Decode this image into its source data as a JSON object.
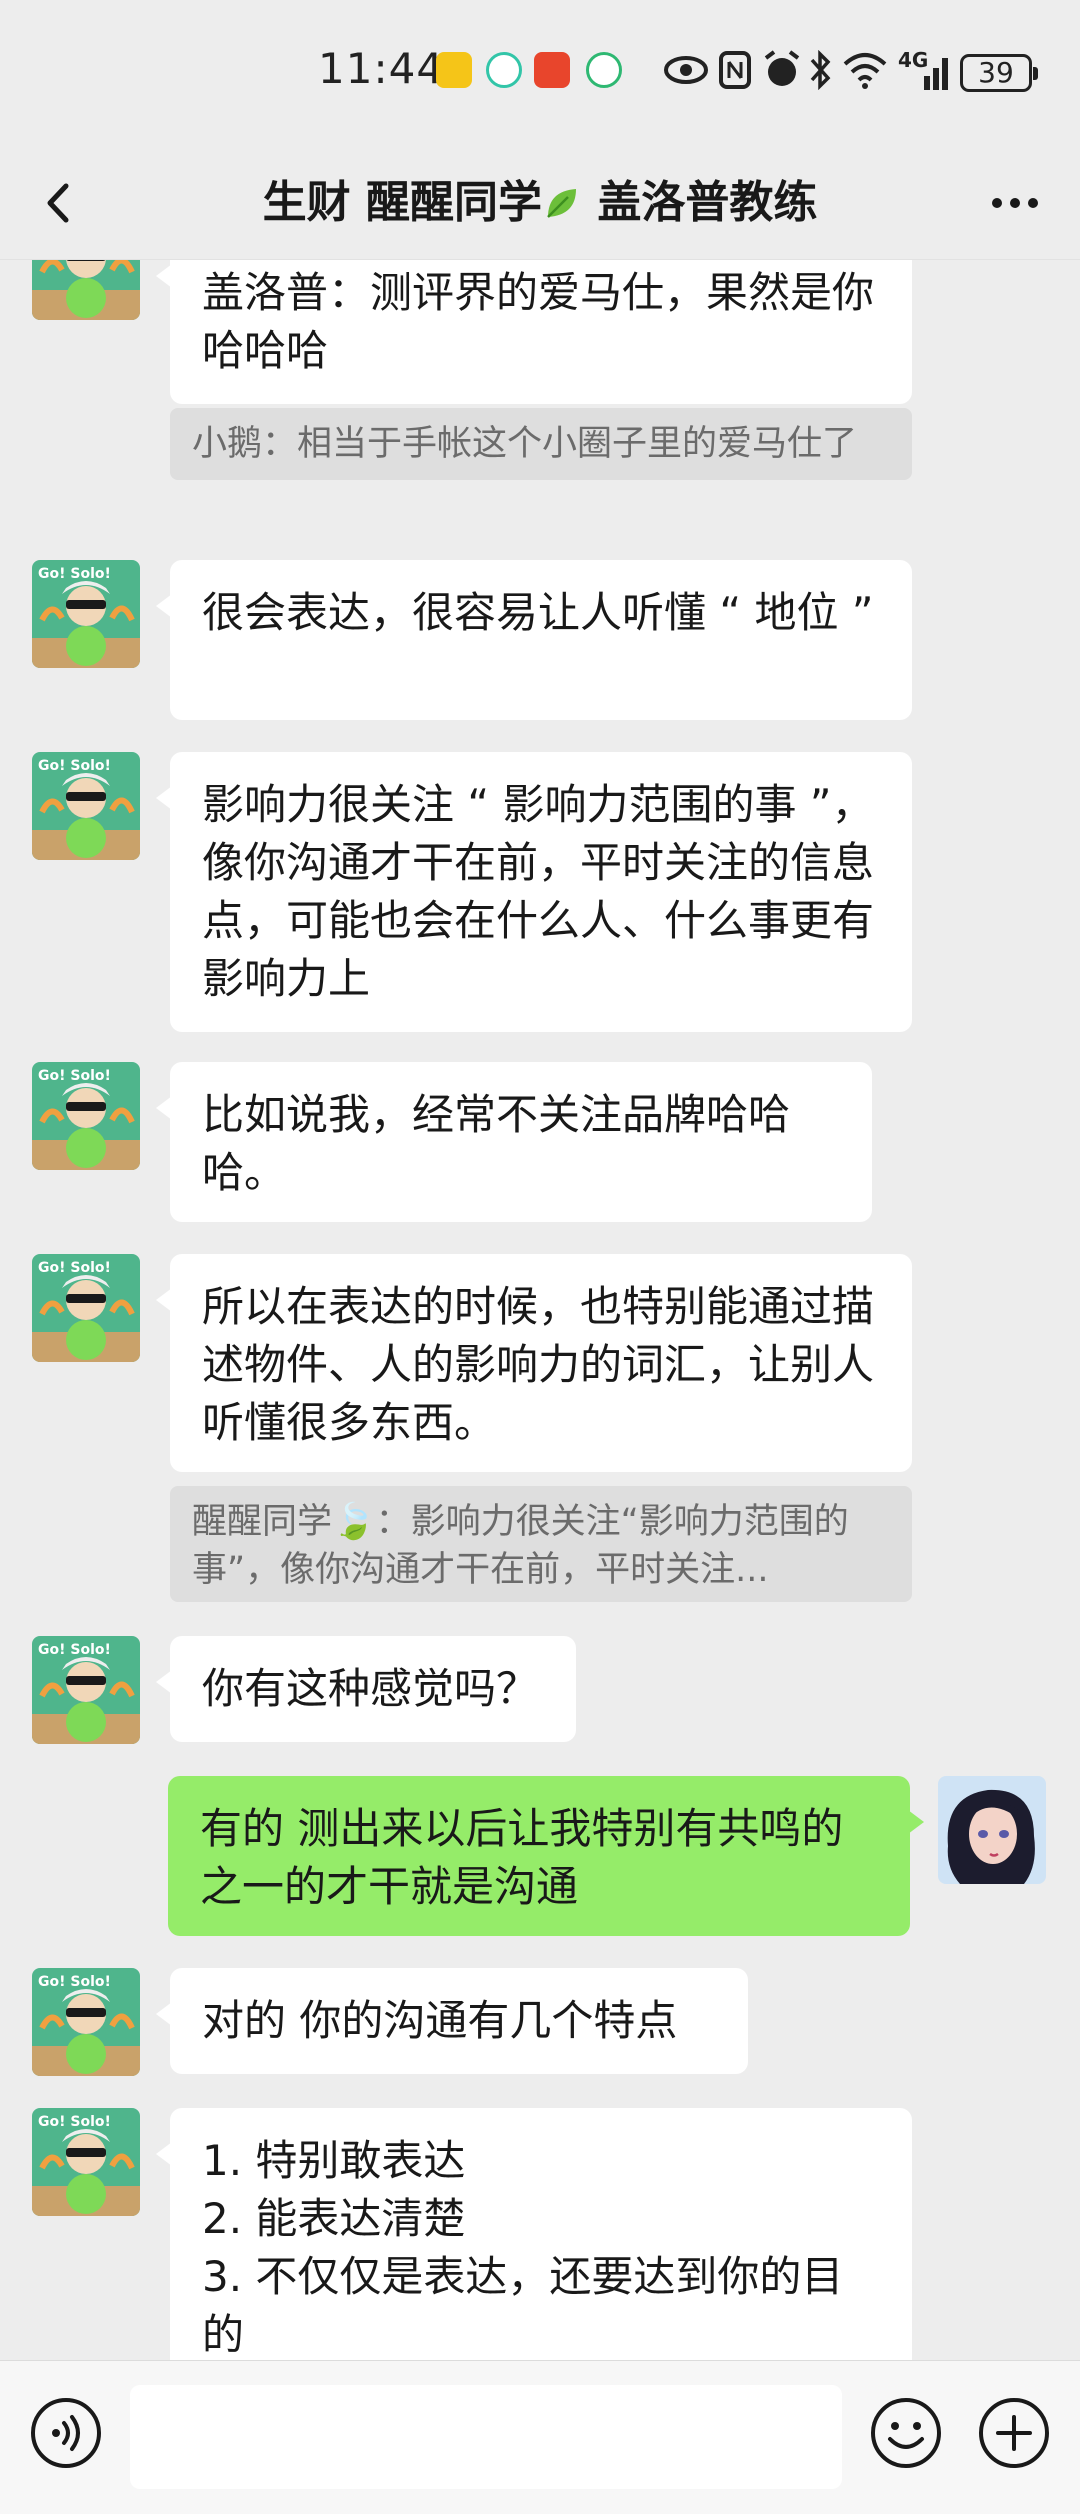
{
  "status_bar": {
    "time": "11:44",
    "battery": "39",
    "signal": "4G"
  },
  "nav": {
    "title_part1": "生财 醒醒同学",
    "title_part2": " 盖洛普教练"
  },
  "messages": [
    {
      "sender": "coach",
      "text": "盖洛普：测评界的爱马仕，果然是你哈哈哈"
    },
    {
      "type": "quote",
      "text": "小鹅：相当于手帐这个小圈子里的爱马仕了"
    },
    {
      "sender": "coach",
      "text": "很会表达，很容易让人听懂 “ 地位 ”"
    },
    {
      "sender": "coach",
      "text": "影响力很关注 “ 影响力范围的事 ”，像你沟通才干在前，平时关注的信息点，可能也会在什么人、什么事更有影响力上"
    },
    {
      "sender": "coach",
      "text": "比如说我，经常不关注品牌哈哈哈。"
    },
    {
      "sender": "coach",
      "text": "所以在表达的时候，也特别能通过描述物件、人的影响力的词汇，让别人听懂很多东西。"
    },
    {
      "type": "quote",
      "text": "醒醒同学🍃：影响力很关注“影响力范围的事”，像你沟通才干在前，平时关注..."
    },
    {
      "sender": "coach",
      "text": "你有这种感觉吗？"
    },
    {
      "sender": "me",
      "text": "有的 测出来以后让我特别有共鸣的之一的才干就是沟通"
    },
    {
      "sender": "coach",
      "text": "对的 你的沟通有几个特点"
    },
    {
      "sender": "coach",
      "lines": [
        "1. 特别敢表达",
        "2. 能表达清楚",
        "3. 不仅仅是表达，还要达到你的目的"
      ]
    }
  ],
  "avatar_text": "Go! Solo!",
  "colors": {
    "background": "#ededed",
    "my_bubble": "#95ec69",
    "other_bubble": "#ffffff",
    "quote_bg": "#dedede"
  }
}
